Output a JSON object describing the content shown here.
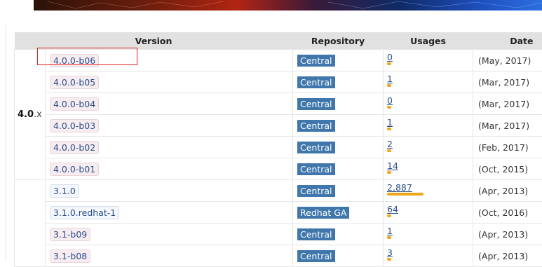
{
  "table": {
    "headers": {
      "version": "Version",
      "repository": "Repository",
      "usages": "Usages",
      "date": "Date"
    },
    "groups": [
      {
        "major": "4.0",
        "suffix": ".x"
      },
      {
        "major": "",
        "suffix": ""
      }
    ],
    "rows": [
      {
        "version": "4.0.0-b06",
        "repository": "Central",
        "usages": "0",
        "usage_fraction": 0.0,
        "date": "(May, 2017)",
        "kind": "beta"
      },
      {
        "version": "4.0.0-b05",
        "repository": "Central",
        "usages": "1",
        "usage_fraction": 0.0003,
        "date": "(Mar, 2017)",
        "kind": "beta"
      },
      {
        "version": "4.0.0-b04",
        "repository": "Central",
        "usages": "0",
        "usage_fraction": 0.0,
        "date": "(Mar, 2017)",
        "kind": "beta"
      },
      {
        "version": "4.0.0-b03",
        "repository": "Central",
        "usages": "1",
        "usage_fraction": 0.0003,
        "date": "(Mar, 2017)",
        "kind": "beta"
      },
      {
        "version": "4.0.0-b02",
        "repository": "Central",
        "usages": "2",
        "usage_fraction": 0.0007,
        "date": "(Feb, 2017)",
        "kind": "beta"
      },
      {
        "version": "4.0.0-b01",
        "repository": "Central",
        "usages": "14",
        "usage_fraction": 0.0049,
        "date": "(Oct, 2015)",
        "kind": "beta"
      },
      {
        "version": "3.1.0",
        "repository": "Central",
        "usages": "2,887",
        "usage_fraction": 1.0,
        "date": "(Apr, 2013)",
        "kind": "release"
      },
      {
        "version": "3.1.0.redhat-1",
        "repository": "Redhat GA",
        "usages": "64",
        "usage_fraction": 0.022,
        "date": "(Oct, 2016)",
        "kind": "release"
      },
      {
        "version": "3.1-b09",
        "repository": "Central",
        "usages": "1",
        "usage_fraction": 0.0003,
        "date": "(Apr, 2013)",
        "kind": "beta"
      },
      {
        "version": "3.1-b08",
        "repository": "Central",
        "usages": "3",
        "usage_fraction": 0.001,
        "date": "(Apr, 2013)",
        "kind": "beta"
      }
    ]
  },
  "colors": {
    "usage_bar": "#f0a818",
    "repo_badge": "#3f76ab",
    "highlight": "#e02424",
    "header_bg": "#e1e1e1"
  }
}
